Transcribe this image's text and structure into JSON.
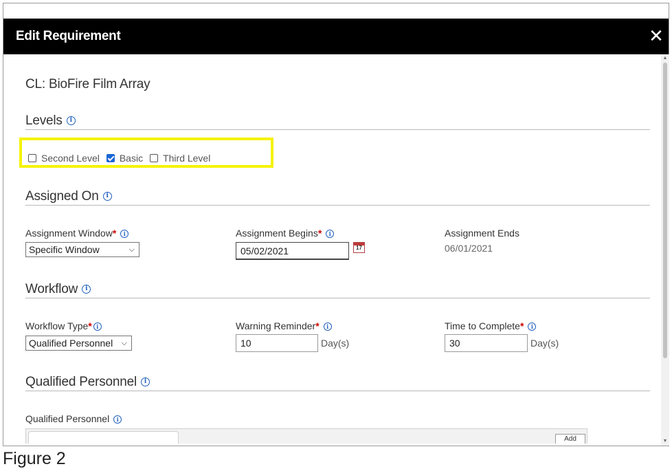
{
  "dialog": {
    "title": "Edit Requirement",
    "close_glyph": "✕"
  },
  "requirement_name": "CL: BioFire Film Array",
  "levels": {
    "title": "Levels",
    "options": [
      {
        "label": "Second Level",
        "checked": false
      },
      {
        "label": "Basic",
        "checked": true
      },
      {
        "label": "Third Level",
        "checked": false
      }
    ]
  },
  "assigned_on": {
    "title": "Assigned On",
    "window_label": "Assignment Window",
    "window_value": "Specific Window",
    "begins_label": "Assignment Begins",
    "begins_value": "05/02/2021",
    "ends_label": "Assignment Ends",
    "ends_value": "06/01/2021",
    "calendar_day": "17"
  },
  "workflow": {
    "title": "Workflow",
    "type_label": "Workflow Type",
    "type_value": "Qualified Personnel",
    "warning_label": "Warning Reminder",
    "warning_value": "10",
    "warning_unit": "Day(s)",
    "complete_label": "Time to Complete",
    "complete_value": "30",
    "complete_unit": "Day(s)"
  },
  "qualified_personnel": {
    "title": "Qualified Personnel",
    "field_label": "Qualified Personnel",
    "add_label": "Add"
  },
  "required_marker": "*",
  "info_glyph": "i",
  "caption": "Figure 2",
  "colors": {
    "header_bg": "#000000",
    "highlight": "#f5f300",
    "required": "#cc0000",
    "info": "#1f5fbf",
    "checkbox": "#1a66d6"
  }
}
